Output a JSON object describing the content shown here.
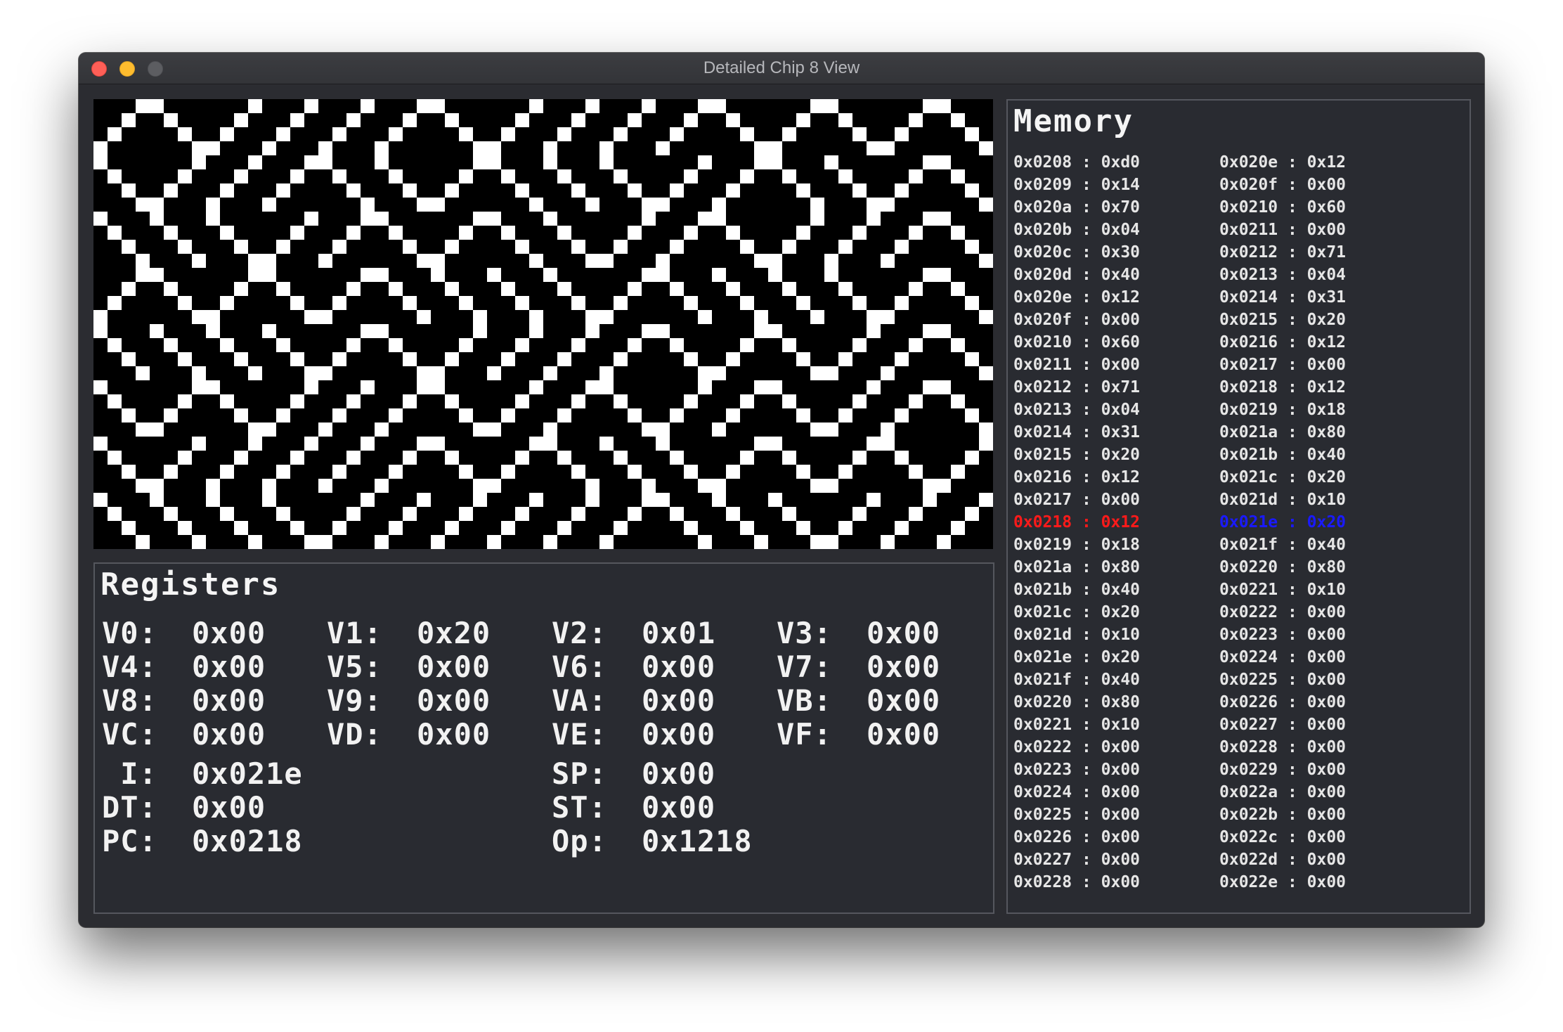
{
  "window": {
    "title": "Detailed Chip 8 View"
  },
  "display": {
    "on_color": "#ffffff",
    "off_color": "#000000",
    "pattern": "diagonal maze (10PRINT) pixel pattern"
  },
  "registers": {
    "title": "Registers",
    "general": [
      {
        "label": "V0:",
        "value": "0x00"
      },
      {
        "label": "V1:",
        "value": "0x20"
      },
      {
        "label": "V2:",
        "value": "0x01"
      },
      {
        "label": "V3:",
        "value": "0x00"
      },
      {
        "label": "V4:",
        "value": "0x00"
      },
      {
        "label": "V5:",
        "value": "0x00"
      },
      {
        "label": "V6:",
        "value": "0x00"
      },
      {
        "label": "V7:",
        "value": "0x00"
      },
      {
        "label": "V8:",
        "value": "0x00"
      },
      {
        "label": "V9:",
        "value": "0x00"
      },
      {
        "label": "VA:",
        "value": "0x00"
      },
      {
        "label": "VB:",
        "value": "0x00"
      },
      {
        "label": "VC:",
        "value": "0x00"
      },
      {
        "label": "VD:",
        "value": "0x00"
      },
      {
        "label": "VE:",
        "value": "0x00"
      },
      {
        "label": "VF:",
        "value": "0x00"
      }
    ],
    "special": {
      "I": {
        "label": " I:",
        "value": "0x021e"
      },
      "SP": {
        "label": "SP:",
        "value": "0x00"
      },
      "DT": {
        "label": "DT:",
        "value": "0x00"
      },
      "ST": {
        "label": "ST:",
        "value": "0x00"
      },
      "PC": {
        "label": "PC:",
        "value": "0x0218"
      },
      "Op": {
        "label": "Op:",
        "value": "0x1218"
      }
    }
  },
  "memory": {
    "title": "Memory",
    "highlight_colors": {
      "pc": "#ff1a1a",
      "i": "#1a1aff"
    },
    "left": [
      {
        "addr": "0x0208",
        "val": "0xd0"
      },
      {
        "addr": "0x0209",
        "val": "0x14"
      },
      {
        "addr": "0x020a",
        "val": "0x70"
      },
      {
        "addr": "0x020b",
        "val": "0x04"
      },
      {
        "addr": "0x020c",
        "val": "0x30"
      },
      {
        "addr": "0x020d",
        "val": "0x40"
      },
      {
        "addr": "0x020e",
        "val": "0x12"
      },
      {
        "addr": "0x020f",
        "val": "0x00"
      },
      {
        "addr": "0x0210",
        "val": "0x60"
      },
      {
        "addr": "0x0211",
        "val": "0x00"
      },
      {
        "addr": "0x0212",
        "val": "0x71"
      },
      {
        "addr": "0x0213",
        "val": "0x04"
      },
      {
        "addr": "0x0214",
        "val": "0x31"
      },
      {
        "addr": "0x0215",
        "val": "0x20"
      },
      {
        "addr": "0x0216",
        "val": "0x12"
      },
      {
        "addr": "0x0217",
        "val": "0x00"
      },
      {
        "addr": "0x0218",
        "val": "0x12",
        "highlight": "pc"
      },
      {
        "addr": "0x0219",
        "val": "0x18"
      },
      {
        "addr": "0x021a",
        "val": "0x80"
      },
      {
        "addr": "0x021b",
        "val": "0x40"
      },
      {
        "addr": "0x021c",
        "val": "0x20"
      },
      {
        "addr": "0x021d",
        "val": "0x10"
      },
      {
        "addr": "0x021e",
        "val": "0x20"
      },
      {
        "addr": "0x021f",
        "val": "0x40"
      },
      {
        "addr": "0x0220",
        "val": "0x80"
      },
      {
        "addr": "0x0221",
        "val": "0x10"
      },
      {
        "addr": "0x0222",
        "val": "0x00"
      },
      {
        "addr": "0x0223",
        "val": "0x00"
      },
      {
        "addr": "0x0224",
        "val": "0x00"
      },
      {
        "addr": "0x0225",
        "val": "0x00"
      },
      {
        "addr": "0x0226",
        "val": "0x00"
      },
      {
        "addr": "0x0227",
        "val": "0x00"
      },
      {
        "addr": "0x0228",
        "val": "0x00"
      }
    ],
    "right": [
      {
        "addr": "0x020e",
        "val": "0x12"
      },
      {
        "addr": "0x020f",
        "val": "0x00"
      },
      {
        "addr": "0x0210",
        "val": "0x60"
      },
      {
        "addr": "0x0211",
        "val": "0x00"
      },
      {
        "addr": "0x0212",
        "val": "0x71"
      },
      {
        "addr": "0x0213",
        "val": "0x04"
      },
      {
        "addr": "0x0214",
        "val": "0x31"
      },
      {
        "addr": "0x0215",
        "val": "0x20"
      },
      {
        "addr": "0x0216",
        "val": "0x12"
      },
      {
        "addr": "0x0217",
        "val": "0x00"
      },
      {
        "addr": "0x0218",
        "val": "0x12"
      },
      {
        "addr": "0x0219",
        "val": "0x18"
      },
      {
        "addr": "0x021a",
        "val": "0x80"
      },
      {
        "addr": "0x021b",
        "val": "0x40"
      },
      {
        "addr": "0x021c",
        "val": "0x20"
      },
      {
        "addr": "0x021d",
        "val": "0x10"
      },
      {
        "addr": "0x021e",
        "val": "0x20",
        "highlight": "i"
      },
      {
        "addr": "0x021f",
        "val": "0x40"
      },
      {
        "addr": "0x0220",
        "val": "0x80"
      },
      {
        "addr": "0x0221",
        "val": "0x10"
      },
      {
        "addr": "0x0222",
        "val": "0x00"
      },
      {
        "addr": "0x0223",
        "val": "0x00"
      },
      {
        "addr": "0x0224",
        "val": "0x00"
      },
      {
        "addr": "0x0225",
        "val": "0x00"
      },
      {
        "addr": "0x0226",
        "val": "0x00"
      },
      {
        "addr": "0x0227",
        "val": "0x00"
      },
      {
        "addr": "0x0228",
        "val": "0x00"
      },
      {
        "addr": "0x0229",
        "val": "0x00"
      },
      {
        "addr": "0x022a",
        "val": "0x00"
      },
      {
        "addr": "0x022b",
        "val": "0x00"
      },
      {
        "addr": "0x022c",
        "val": "0x00"
      },
      {
        "addr": "0x022d",
        "val": "0x00"
      },
      {
        "addr": "0x022e",
        "val": "0x00"
      }
    ]
  }
}
